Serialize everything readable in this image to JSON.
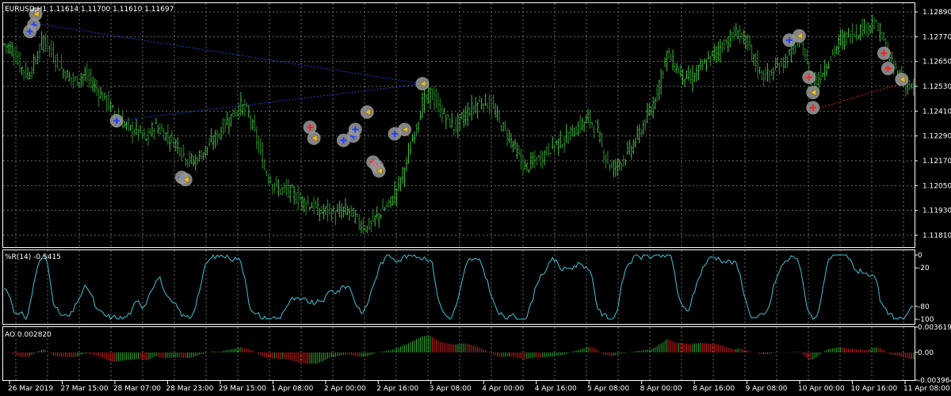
{
  "symbol_line": "EURUSD,H1  1.11614 1.11700 1.11610 1.11697",
  "wpr_label": "%R(14) -0.5415",
  "ao_label": "AO 0.002820",
  "colors": {
    "bg": "#000000",
    "grid": "#6a6a6a",
    "bull": "#3fbf3f",
    "bear": "#2a8a2a",
    "wpr_line": "#3ec3d8",
    "ao_up": "#2fa82f",
    "ao_down": "#d02020",
    "buy_line": "#1f3fcf",
    "sell_line": "#d02020",
    "text": "#ffffff"
  },
  "chart_data": [
    {
      "type": "candlestick",
      "title": "EURUSD,H1  1.11614 1.11700 1.11610 1.11697",
      "price_axis_ticks": [
        "1.12890",
        "1.12770",
        "1.12650",
        "1.12530",
        "1.12410",
        "1.12290",
        "1.12170",
        "1.12050",
        "1.11930",
        "1.11810"
      ],
      "ylim": [
        1.1179,
        1.1291
      ],
      "time_axis_ticks": [
        "26 Mar 2019",
        "27 Mar 15:00",
        "28 Mar 07:00",
        "28 Mar 23:00",
        "29 Mar 15:00",
        "1 Apr 08:00",
        "2 Apr 00:00",
        "2 Apr 16:00",
        "3 Apr 08:00",
        "4 Apr 00:00",
        "4 Apr 16:00",
        "5 Apr 08:00",
        "8 Apr 00:00",
        "8 Apr 16:00",
        "9 Apr 08:00",
        "10 Apr 00:00",
        "10 Apr 16:00",
        "11 Apr 08:00"
      ],
      "close_path": [
        [
          0,
          1.1272
        ],
        [
          4,
          1.127
        ],
        [
          8,
          1.1262
        ],
        [
          12,
          1.1258
        ],
        [
          16,
          1.1265
        ],
        [
          20,
          1.1275
        ],
        [
          24,
          1.1268
        ],
        [
          28,
          1.1262
        ],
        [
          32,
          1.1258
        ],
        [
          36,
          1.1255
        ],
        [
          40,
          1.1258
        ],
        [
          44,
          1.1255
        ],
        [
          48,
          1.125
        ],
        [
          52,
          1.1246
        ],
        [
          56,
          1.124
        ],
        [
          60,
          1.1236
        ],
        [
          64,
          1.1233
        ],
        [
          68,
          1.1232
        ],
        [
          72,
          1.1228
        ],
        [
          76,
          1.1235
        ],
        [
          80,
          1.1232
        ],
        [
          84,
          1.1229
        ],
        [
          88,
          1.1226
        ],
        [
          92,
          1.122
        ],
        [
          96,
          1.1218
        ],
        [
          100,
          1.1222
        ],
        [
          104,
          1.1226
        ],
        [
          108,
          1.123
        ],
        [
          112,
          1.1236
        ],
        [
          116,
          1.124
        ],
        [
          120,
          1.1244
        ],
        [
          124,
          1.124
        ],
        [
          128,
          1.1228
        ],
        [
          132,
          1.1215
        ],
        [
          136,
          1.1208
        ],
        [
          140,
          1.1205
        ],
        [
          144,
          1.1205
        ],
        [
          148,
          1.1202
        ],
        [
          152,
          1.12
        ],
        [
          156,
          1.1198
        ],
        [
          160,
          1.1195
        ],
        [
          164,
          1.1196
        ],
        [
          168,
          1.1194
        ],
        [
          172,
          1.1196
        ],
        [
          176,
          1.1195
        ],
        [
          180,
          1.119
        ],
        [
          184,
          1.1188
        ],
        [
          188,
          1.1192
        ],
        [
          192,
          1.1196
        ],
        [
          196,
          1.12
        ],
        [
          200,
          1.1208
        ],
        [
          204,
          1.1218
        ],
        [
          208,
          1.1232
        ],
        [
          212,
          1.1245
        ],
        [
          216,
          1.125
        ],
        [
          220,
          1.1243
        ],
        [
          224,
          1.1238
        ],
        [
          228,
          1.1234
        ],
        [
          232,
          1.1238
        ],
        [
          236,
          1.1242
        ],
        [
          240,
          1.1245
        ],
        [
          244,
          1.1246
        ],
        [
          248,
          1.1242
        ],
        [
          252,
          1.1235
        ],
        [
          256,
          1.123
        ],
        [
          260,
          1.1222
        ],
        [
          264,
          1.1215
        ],
        [
          268,
          1.1218
        ],
        [
          272,
          1.122
        ],
        [
          276,
          1.1224
        ],
        [
          280,
          1.1227
        ],
        [
          284,
          1.1228
        ],
        [
          288,
          1.1232
        ],
        [
          292,
          1.1235
        ],
        [
          296,
          1.1238
        ],
        [
          300,
          1.1234
        ],
        [
          304,
          1.1222
        ],
        [
          308,
          1.1215
        ],
        [
          312,
          1.1218
        ],
        [
          316,
          1.1222
        ],
        [
          320,
          1.1228
        ],
        [
          324,
          1.1235
        ],
        [
          328,
          1.1242
        ],
        [
          332,
          1.1255
        ],
        [
          336,
          1.1268
        ],
        [
          340,
          1.1262
        ],
        [
          344,
          1.1258
        ],
        [
          348,
          1.1256
        ],
        [
          352,
          1.126
        ],
        [
          356,
          1.1264
        ],
        [
          360,
          1.1268
        ],
        [
          364,
          1.1272
        ],
        [
          368,
          1.1275
        ],
        [
          372,
          1.1278
        ],
        [
          376,
          1.1273
        ],
        [
          380,
          1.1265
        ],
        [
          384,
          1.1258
        ],
        [
          388,
          1.1258
        ],
        [
          392,
          1.1262
        ],
        [
          396,
          1.1265
        ],
        [
          400,
          1.127
        ],
        [
          404,
          1.1274
        ],
        [
          408,
          1.1258
        ],
        [
          412,
          1.1255
        ],
        [
          416,
          1.1262
        ],
        [
          420,
          1.1268
        ],
        [
          424,
          1.1274
        ],
        [
          428,
          1.1276
        ],
        [
          432,
          1.1278
        ],
        [
          436,
          1.128
        ],
        [
          440,
          1.1282
        ],
        [
          444,
          1.1278
        ],
        [
          448,
          1.1266
        ],
        [
          452,
          1.126
        ],
        [
          456,
          1.1255
        ],
        [
          460,
          1.1252
        ]
      ],
      "trade_lines": [
        {
          "side": "buy",
          "from": [
            14,
            1.1282
          ],
          "to": [
            212,
            1.1254
          ]
        },
        {
          "side": "buy",
          "from": [
            212,
            1.1254
          ],
          "to": [
            57,
            1.1237
          ]
        },
        {
          "side": "sell",
          "from": [
            410,
            1.1242
          ],
          "to": [
            458,
            1.1255
          ]
        }
      ],
      "markers": [
        {
          "kind": "close",
          "at": [
            16,
            1.1286
          ]
        },
        {
          "kind": "buy",
          "at": [
            15,
            1.1281
          ]
        },
        {
          "kind": "buy",
          "at": [
            13,
            1.1278
          ]
        },
        {
          "kind": "close",
          "at": [
            212,
            1.1254
          ]
        },
        {
          "kind": "buy",
          "at": [
            57,
            1.1237
          ]
        },
        {
          "kind": "buy",
          "at": [
            90,
            1.1211
          ]
        },
        {
          "kind": "close",
          "at": [
            92,
            1.121
          ]
        },
        {
          "kind": "sell",
          "at": [
            155,
            1.1234
          ]
        },
        {
          "kind": "close",
          "at": [
            157,
            1.1229
          ]
        },
        {
          "kind": "buy",
          "at": [
            172,
            1.1228
          ]
        },
        {
          "kind": "buy",
          "at": [
            177,
            1.123
          ]
        },
        {
          "kind": "buy",
          "at": [
            178,
            1.1233
          ]
        },
        {
          "kind": "close",
          "at": [
            184,
            1.1241
          ]
        },
        {
          "kind": "sell",
          "at": [
            187,
            1.1218
          ]
        },
        {
          "kind": "sell",
          "at": [
            189,
            1.1216
          ]
        },
        {
          "kind": "close",
          "at": [
            190,
            1.1214
          ]
        },
        {
          "kind": "buy",
          "at": [
            198,
            1.1231
          ]
        },
        {
          "kind": "close",
          "at": [
            203,
            1.1233
          ]
        },
        {
          "kind": "buy",
          "at": [
            398,
            1.1274
          ]
        },
        {
          "kind": "close",
          "at": [
            403,
            1.1276
          ]
        },
        {
          "kind": "sell",
          "at": [
            408,
            1.1257
          ]
        },
        {
          "kind": "close",
          "at": [
            410,
            1.125
          ]
        },
        {
          "kind": "sell",
          "at": [
            410,
            1.1243
          ]
        },
        {
          "kind": "sell",
          "at": [
            446,
            1.1268
          ]
        },
        {
          "kind": "sell",
          "at": [
            448,
            1.1261
          ]
        },
        {
          "kind": "close",
          "at": [
            455,
            1.1256
          ]
        }
      ]
    },
    {
      "type": "line",
      "title": "%R(14) -0.5415",
      "axis_ticks": [
        "0",
        "-20",
        "-80",
        "-100"
      ],
      "ylim": [
        -100,
        0
      ]
    },
    {
      "type": "bar",
      "title": "AO 0.002820",
      "axis_ticks": [
        "0.003619",
        "0.00",
        "-0.003964"
      ],
      "ylim": [
        -0.003964,
        0.003619
      ]
    }
  ]
}
